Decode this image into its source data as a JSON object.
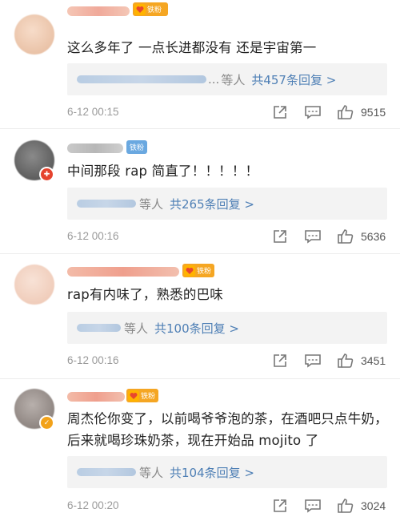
{
  "comments": [
    {
      "text": "这么多年了 一点长进都没有 还是宇宙第一",
      "fan_badge": "铁粉",
      "reply_ellipsis": "...",
      "reply_who": "等人",
      "reply_count": "共457条回复 >",
      "date": "6-12 00:15",
      "likes": "9515"
    },
    {
      "text": "中间那段 rap 简直了！！！！！",
      "fan_badge": "铁粉",
      "reply_ellipsis": "",
      "reply_who": "等人",
      "reply_count": "共265条回复 >",
      "date": "6-12 00:16",
      "likes": "5636"
    },
    {
      "text": "rap有内味了，熟悉的巴味",
      "fan_badge": "铁粉",
      "reply_ellipsis": "",
      "reply_who": "等人",
      "reply_count": "共100条回复 >",
      "date": "6-12 00:16",
      "likes": "3451"
    },
    {
      "text": "周杰伦你变了，以前喝爷爷泡的茶，在酒吧只点牛奶，后来就喝珍珠奶茶，现在开始品 mojito 了",
      "fan_badge": "铁粉",
      "reply_ellipsis": "",
      "reply_who": "等人",
      "reply_count": "共104条回复 >",
      "date": "6-12 00:20",
      "likes": "3024"
    }
  ],
  "icons": {
    "share": "share-icon",
    "comment": "comment-icon",
    "like": "thumbs-up-icon",
    "fan": "heart-fan-icon"
  },
  "colors": {
    "link": "#4e7fb5",
    "fan_badge_gold": "#f5a623",
    "fan_badge_blue": "#6aa8e0",
    "reply_bg": "#f3f3f3",
    "meta_gray": "#9a9a9a"
  }
}
